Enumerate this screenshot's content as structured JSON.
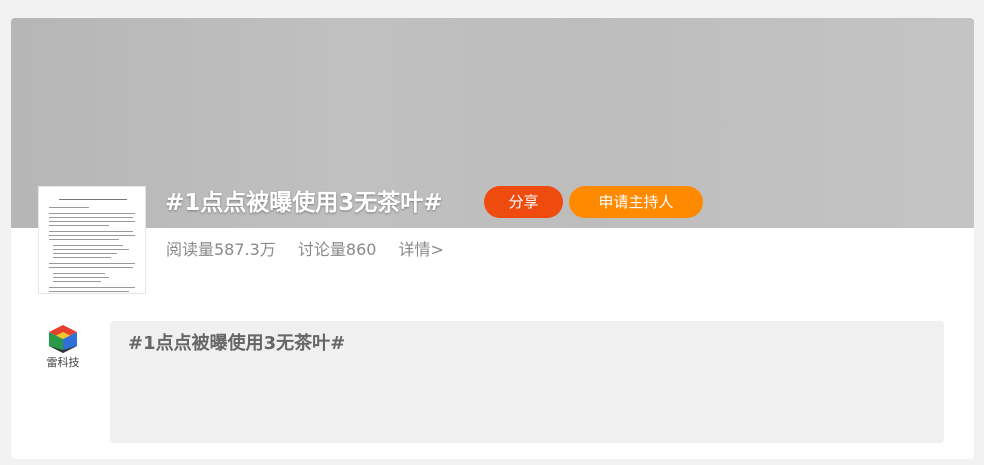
{
  "topic": {
    "title": "#1点点被曝使用3无茶叶#",
    "share_label": "分享",
    "apply_host_label": "申请主持人",
    "stats": {
      "reads": "阅读量587.3万",
      "discussions": "讨论量860",
      "detail": "详情>"
    }
  },
  "post": {
    "author": "雷科技",
    "text": "#1点点被曝使用3无茶叶#"
  },
  "colors": {
    "share_button": "#ef4b0e",
    "apply_host_button": "#ff8a00",
    "banner": "#bdbdbd",
    "post_background": "#f0f0f0"
  },
  "icons": {
    "thumbnail": "document-thumbnail",
    "author_logo": "colored-cube-logo"
  }
}
